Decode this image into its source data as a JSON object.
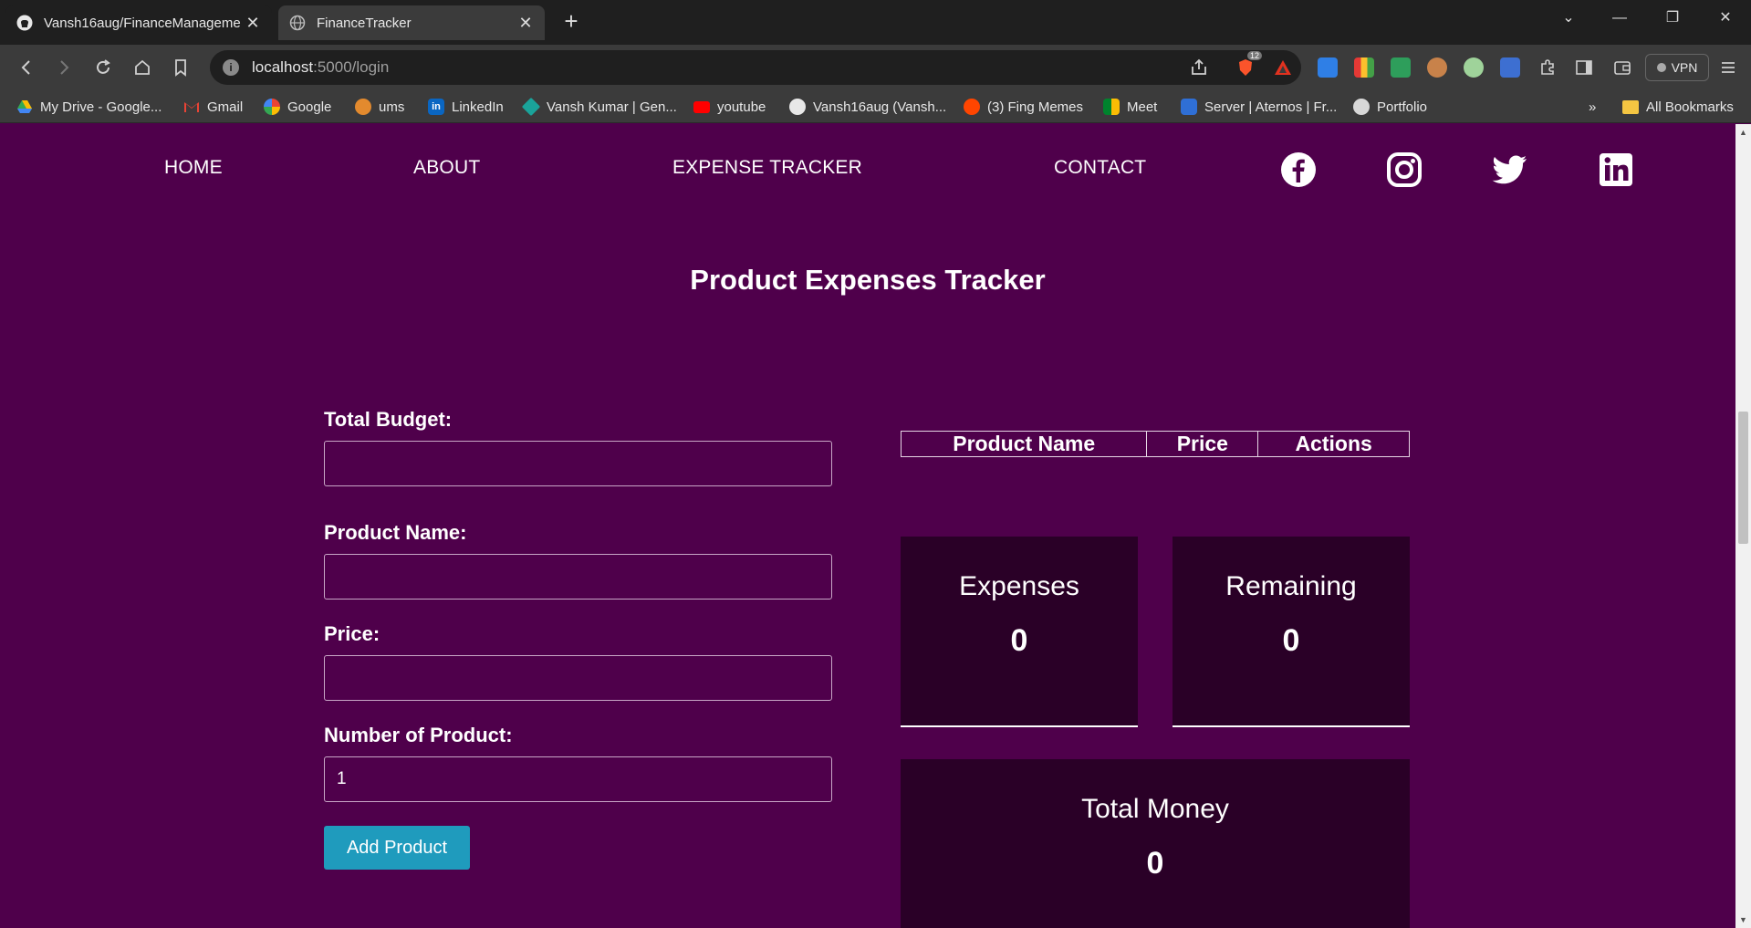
{
  "browser": {
    "tabs": [
      {
        "title": "Vansh16aug/FinanceManageme",
        "active": false
      },
      {
        "title": "FinanceTracker",
        "active": true
      }
    ],
    "address": {
      "host": "localhost",
      "path": ":5000/login"
    },
    "shield_badge": "12",
    "vpn_label": "VPN",
    "bookmarks": [
      {
        "label": "My Drive - Google...",
        "icon": "google-drive-icon"
      },
      {
        "label": "Gmail",
        "icon": "gmail-icon"
      },
      {
        "label": "Google",
        "icon": "google-icon"
      },
      {
        "label": "ums",
        "icon": "ums-icon"
      },
      {
        "label": "LinkedIn",
        "icon": "linkedin-icon"
      },
      {
        "label": "Vansh Kumar | Gen...",
        "icon": "diamond-icon"
      },
      {
        "label": "youtube",
        "icon": "youtube-icon"
      },
      {
        "label": "Vansh16aug (Vansh...",
        "icon": "github-icon"
      },
      {
        "label": "(3) Fing Memes",
        "icon": "reddit-icon"
      },
      {
        "label": "Meet",
        "icon": "meet-icon"
      },
      {
        "label": "Server | Aternos | Fr...",
        "icon": "aternos-icon"
      },
      {
        "label": "Portfolio",
        "icon": "portfolio-icon"
      }
    ],
    "overflow_label": "»",
    "all_bookmarks": "All Bookmarks"
  },
  "site": {
    "nav": [
      "HOME",
      "ABOUT",
      "EXPENSE TRACKER",
      "CONTACT"
    ],
    "social": [
      "facebook-icon",
      "instagram-icon",
      "twitter-icon",
      "linkedin-icon"
    ],
    "heading": "Product Expenses Tracker",
    "form": {
      "total_budget_label": "Total Budget:",
      "total_budget_value": "",
      "product_name_label": "Product Name:",
      "product_name_value": "",
      "price_label": "Price:",
      "price_value": "",
      "quantity_label": "Number of Product:",
      "quantity_value": "1",
      "add_button": "Add Product"
    },
    "table": {
      "headers": [
        "Product Name",
        "Price",
        "Actions"
      ],
      "rows": []
    },
    "summary": {
      "expenses_label": "Expenses",
      "expenses_value": "0",
      "remaining_label": "Remaining",
      "remaining_value": "0",
      "total_label": "Total Money",
      "total_value": "0"
    }
  },
  "colors": {
    "page_bg": "#4f004b",
    "card_bg": "#2a0027",
    "button_bg": "#1f9bbd"
  }
}
